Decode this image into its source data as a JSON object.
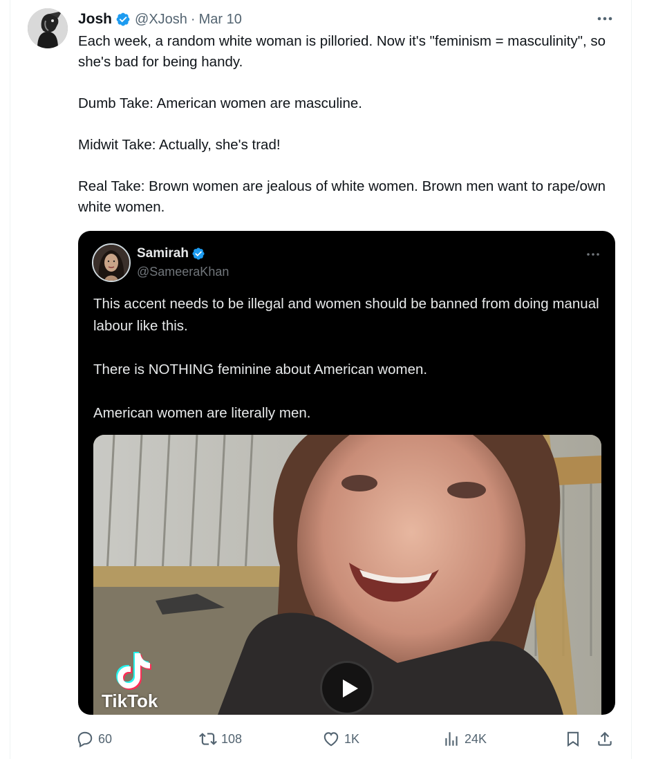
{
  "author": {
    "name": "Josh",
    "handle": "@XJosh",
    "separator": "·",
    "date": "Mar 10"
  },
  "tweet": {
    "text": "Each week, a random white woman is pilloried. Now it's \"feminism = masculinity\", so she's bad for being handy.\n\nDumb Take: American women are masculine.\n\nMidwit Take: Actually, she's trad!\n\nReal Take: Brown women are jealous of white women. Brown men want to rape/own white women."
  },
  "quote": {
    "name": "Samirah",
    "handle": "@SameeraKhan",
    "text": "This accent needs to be illegal and women should be banned from doing manual labour like this.\n\nThere is NOTHING feminine about American women.\n\nAmerican women are literally men.",
    "media": {
      "watermark": "TikTok"
    }
  },
  "actions": {
    "replies": "60",
    "reposts": "108",
    "likes": "1K",
    "views": "24K"
  },
  "colors": {
    "verified_blue": "#1d9bf0",
    "icon_gray": "#536471",
    "quote_bg": "#000000"
  },
  "icons": [
    "verified-badge-icon",
    "more-options-icon",
    "reply-icon",
    "repost-icon",
    "like-icon",
    "views-icon",
    "bookmark-icon",
    "share-icon",
    "play-icon",
    "tiktok-logo-icon"
  ]
}
